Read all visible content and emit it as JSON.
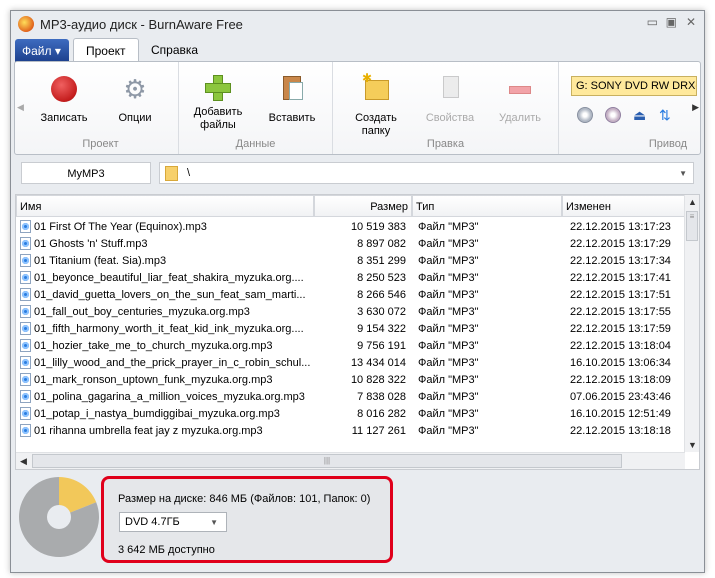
{
  "window": {
    "title": "MP3-аудио диск - BurnAware Free"
  },
  "menu": {
    "file_label": "Файл",
    "tabs": [
      {
        "label": "Проект",
        "active": true
      },
      {
        "label": "Справка"
      }
    ]
  },
  "ribbon": {
    "groups": [
      {
        "label": "Проект",
        "buttons": [
          {
            "label": "Записать",
            "icon": "record-icon"
          },
          {
            "label": "Опции",
            "icon": "gears-icon"
          }
        ]
      },
      {
        "label": "Данные",
        "buttons": [
          {
            "label": "Добавить файлы",
            "icon": "add-plus-icon"
          },
          {
            "label": "Вставить",
            "icon": "paste-clipboard-icon"
          }
        ]
      },
      {
        "label": "Правка",
        "buttons": [
          {
            "label": "Создать папку",
            "icon": "new-folder-icon"
          },
          {
            "label": "Свойства",
            "icon": "properties-icon",
            "disabled": true
          },
          {
            "label": "Удалить",
            "icon": "delete-minus-icon",
            "disabled": true
          }
        ]
      },
      {
        "label": "Привод",
        "drive": "G: SONY DVD RW DRX-S",
        "icons": [
          "disc-info-icon",
          "disc-erase-icon",
          "eject-icon",
          "refresh-icon"
        ]
      }
    ]
  },
  "path": {
    "disc_name": "MyMP3",
    "current_path": "\\"
  },
  "list": {
    "columns": [
      "Имя",
      "Размер",
      "Тип",
      "Изменен"
    ],
    "rows": [
      [
        "01 First Of The Year (Equinox).mp3",
        "10 519 383",
        "Файл \"MP3\"",
        "22.12.2015 13:17:23"
      ],
      [
        "01 Ghosts 'n' Stuff.mp3",
        "8 897 082",
        "Файл \"MP3\"",
        "22.12.2015 13:17:29"
      ],
      [
        "01 Titanium (feat. Sia).mp3",
        "8 351 299",
        "Файл \"MP3\"",
        "22.12.2015 13:17:34"
      ],
      [
        "01_beyonce_beautiful_liar_feat_shakira_myzuka.org....",
        "8 250 523",
        "Файл \"MP3\"",
        "22.12.2015 13:17:41"
      ],
      [
        "01_david_guetta_lovers_on_the_sun_feat_sam_marti...",
        "8 266 546",
        "Файл \"MP3\"",
        "22.12.2015 13:17:51"
      ],
      [
        "01_fall_out_boy_centuries_myzuka.org.mp3",
        "3 630 072",
        "Файл \"MP3\"",
        "22.12.2015 13:17:55"
      ],
      [
        "01_fifth_harmony_worth_it_feat_kid_ink_myzuka.org....",
        "9 154 322",
        "Файл \"MP3\"",
        "22.12.2015 13:17:59"
      ],
      [
        "01_hozier_take_me_to_church_myzuka.org.mp3",
        "9 756 191",
        "Файл \"MP3\"",
        "22.12.2015 13:18:04"
      ],
      [
        "01_lilly_wood_and_the_prick_prayer_in_c_robin_schul...",
        "13 434 014",
        "Файл \"MP3\"",
        "16.10.2015 13:06:34"
      ],
      [
        "01_mark_ronson_uptown_funk_myzuka.org.mp3",
        "10 828 322",
        "Файл \"MP3\"",
        "22.12.2015 13:18:09"
      ],
      [
        "01_polina_gagarina_a_million_voices_myzuka.org.mp3",
        "7 838 028",
        "Файл \"MP3\"",
        "07.06.2015 23:43:46"
      ],
      [
        "01_potap_i_nastya_bumdiggibai_myzuka.org.mp3",
        "8 016 282",
        "Файл \"MP3\"",
        "16.10.2015 12:51:49"
      ],
      [
        "01 rihanna umbrella feat jay z myzuka.org.mp3",
        "11 127 261",
        "Файл \"MP3\"",
        "22.12.2015 13:18:18"
      ]
    ]
  },
  "status": {
    "disk_size": "Размер на диске: 846 МБ (Файлов: 101, Папок: 0)",
    "disc_type": "DVD 4.7ГБ",
    "available": "3 642 МБ доступно",
    "used_fraction": 0.19,
    "colors": {
      "used": "#f2c85a",
      "free": "#a9abad",
      "highlight": "#e0001b"
    }
  }
}
